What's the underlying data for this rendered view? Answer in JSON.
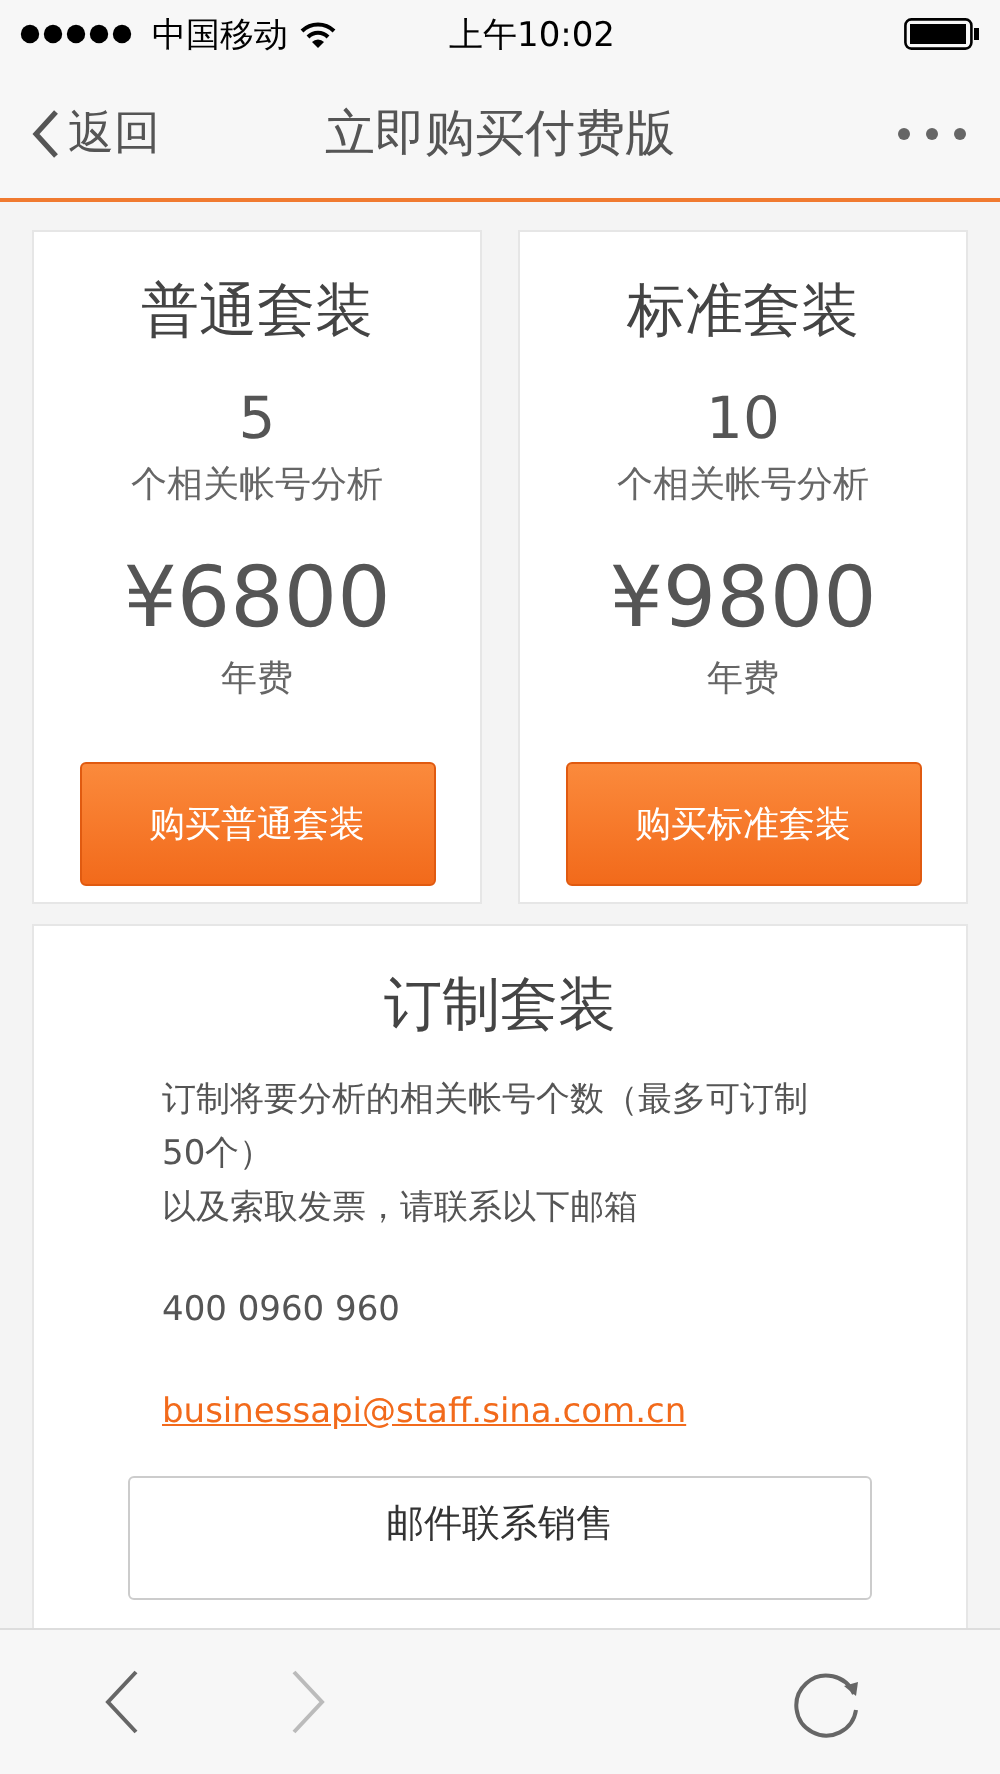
{
  "status_bar": {
    "carrier": "中国移动",
    "time": "上午10:02"
  },
  "nav": {
    "back": "返回",
    "title": "立即购买付费版"
  },
  "plans": [
    {
      "name": "普通套装",
      "count": "5",
      "count_label": "个相关帐号分析",
      "price": "¥6800",
      "price_label": "年费",
      "button": "购买普通套装"
    },
    {
      "name": "标准套装",
      "count": "10",
      "count_label": "个相关帐号分析",
      "price": "¥9800",
      "price_label": "年费",
      "button": "购买标准套装"
    }
  ],
  "custom": {
    "title": "订制套装",
    "description": "订制将要分析的相关帐号个数（最多可订制50个）",
    "description_2": "以及索取发票，请联系以下邮箱",
    "phone": "400 0960 960",
    "email": "businessapi@staff.sina.com.cn",
    "button": "邮件联系销售"
  },
  "toolbar": {
    "back_disabled": false,
    "forward_disabled": true
  }
}
